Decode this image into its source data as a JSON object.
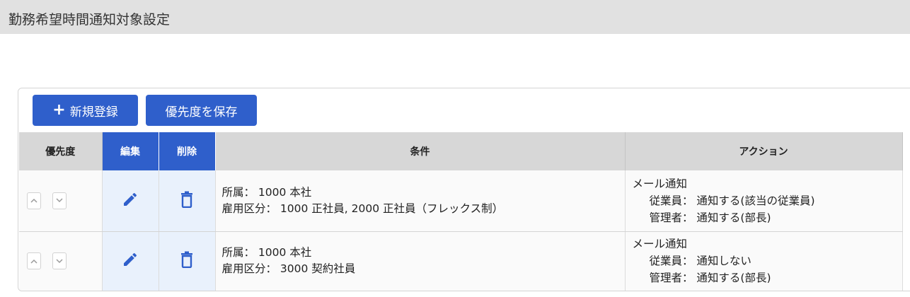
{
  "page": {
    "title": "勤務希望時間通知対象設定"
  },
  "toolbar": {
    "new_label": "新規登録",
    "save_label": "優先度を保存"
  },
  "table": {
    "headers": {
      "priority": "優先度",
      "edit": "編集",
      "delete": "削除",
      "condition": "条件",
      "action": "アクション"
    },
    "rows": [
      {
        "condition_lines": [
          "所属： 1000 本社",
          "雇用区分： 1000 正社員, 2000 正社員（フレックス制）"
        ],
        "action_title": "メール通知",
        "action_lines": [
          "従業員： 通知する(該当の従業員)",
          "管理者： 通知する(部長)"
        ]
      },
      {
        "condition_lines": [
          "所属： 1000 本社",
          "雇用区分： 3000 契約社員"
        ],
        "action_title": "メール通知",
        "action_lines": [
          "従業員： 通知しない",
          "管理者： 通知する(部長)"
        ]
      }
    ]
  },
  "icons": {
    "edit": "pencil-icon",
    "delete": "trash-icon",
    "up": "chevron-up-icon",
    "down": "chevron-down-icon"
  },
  "colors": {
    "accent": "#2f5fcb",
    "title_bar": "#e1e1e1",
    "icon_cell": "#e9f1fc"
  }
}
